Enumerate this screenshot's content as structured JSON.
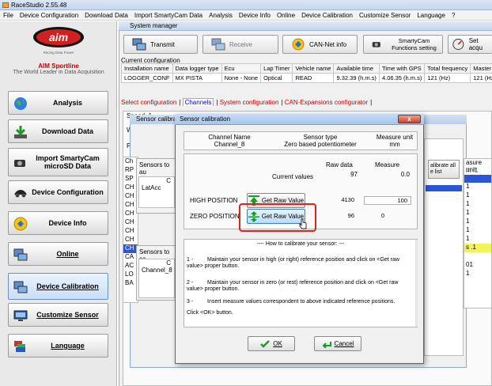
{
  "app": {
    "title": "RaceStudio 2.55.48",
    "menu": [
      "File",
      "Device Configuration",
      "Download Data",
      "Import SmartyCam Data",
      "Analysis",
      "Device Info",
      "Online",
      "Device Calibration",
      "Customize Sensor",
      "Language",
      "?"
    ]
  },
  "sidebar": {
    "brand_name": "AIM Sportline",
    "brand_tagline": "The World Leader in Data Acquisition",
    "logo_subtext": "Racing Data Power",
    "buttons": [
      {
        "label": "Analysis",
        "icon": "globe-icon"
      },
      {
        "label": "Download Data",
        "icon": "download-icon"
      },
      {
        "label": "Import SmartyCam microSD Data",
        "icon": "camera-icon"
      },
      {
        "label": "Device Configuration",
        "icon": "car-icon"
      },
      {
        "label": "Device Info",
        "icon": "info-icon"
      },
      {
        "label": "Online",
        "icon": "computer-icon"
      },
      {
        "label": "Device Calibration",
        "icon": "computer-icon"
      },
      {
        "label": "Customize Sensor",
        "icon": "monitor-icon"
      },
      {
        "label": "Language",
        "icon": "flags-icon"
      }
    ]
  },
  "system_manager": {
    "title": "System manager",
    "toolbar": {
      "transmit": "Transmit",
      "receive": "Receive",
      "can_net": "CAN-Net info",
      "smartycam": "SmartyCam Functions setting",
      "set_acq": "Set acqu"
    },
    "current_configuration_label": "Current configuration",
    "config_table": {
      "headers": [
        "Installation name",
        "Data logger type",
        "Ecu",
        "Lap Timer",
        "Vehicle name",
        "Available time",
        "Time with GPS",
        "Total frequency",
        "Master"
      ],
      "row": [
        "LOGGER_CONF",
        "MX PISTA",
        "None - None",
        "Optical",
        "READ",
        "9.32.39 (h.m.s)",
        "4.06.35 (h.m.s)",
        "121 (Hz)",
        "121 (Hz"
      ]
    },
    "tabs": [
      "Select configuration",
      "Channels",
      "System configuration",
      "CAN-Expansions configurator"
    ]
  },
  "background_window": {
    "title": "Sensor calibrati",
    "speed_label": "Speed_1",
    "wh_label": "Wh",
    "pu_label": "Pu",
    "sensors_auto_label": "Sensors to au",
    "sensors_cal_label": "Sensors to ca",
    "col_c": "C",
    "latacc": "LatAcc",
    "channel_cut": "Channel_8",
    "left_rows": [
      "Ch",
      "RP",
      "SP",
      "CH",
      "CH",
      "CH",
      "CH",
      "CH",
      "CH",
      "CH",
      "CH",
      "CA",
      "AC",
      "LO",
      "BA"
    ],
    "right_header": "asure unit",
    "right_sub": "/h .1",
    "calibrate_all": "alibrate all e list",
    "right_vals": [
      "1",
      "1",
      "1",
      "1",
      "1",
      "1",
      "1",
      "s .1",
      "01",
      "1"
    ]
  },
  "dialog": {
    "title": "Sensor calibration",
    "close": "x",
    "channel_name_header": "Channel Name",
    "channel_name": "Channel_8",
    "sensor_type_header": "Sensor type",
    "sensor_type": "Zero based potentiometer",
    "measure_unit_header": "Measure unit",
    "measure_unit": "mm",
    "raw_data_header": "Raw data",
    "measure_header": "Measure",
    "current_values_label": "Current values",
    "current_raw": "97",
    "current_measure": "0.0",
    "high_label": "HIGH POSITION",
    "high_raw": "4130",
    "high_measure": "100",
    "zero_label": "ZERO POSITION",
    "zero_raw": "96",
    "zero_measure": "0",
    "get_raw_label": "Get Raw Value",
    "howto_title": "---- How to calibrate your sensor: ---",
    "steps": [
      {
        "num": "1 -",
        "text": "Maintain your sensor in high (or right) reference position and click on <Get raw value> proper button."
      },
      {
        "num": "2 -",
        "text": "Maintain your sensor in zero (or rest) reference position and click on <Get raw value> proper button."
      },
      {
        "num": "3 -",
        "text": "Insert measure values correspondent to above indicated reference positions."
      }
    ],
    "click_ok": "Click <OK> button.",
    "ok_label": "OK",
    "cancel_label": "Cancel"
  }
}
